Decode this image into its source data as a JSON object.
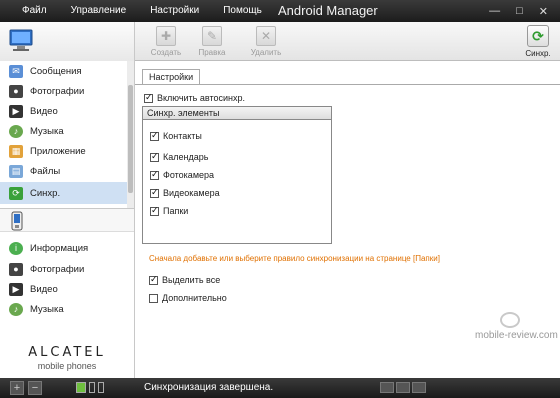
{
  "menu": {
    "items": [
      "Файл",
      "Управление",
      "Настройки",
      "Помощь"
    ]
  },
  "app_title": "Android Manager",
  "toolbar": {
    "create": "Создать",
    "edit": "Правка",
    "delete": "Удалить",
    "sync": "Синхр."
  },
  "sidebar": {
    "items": [
      "Сообщения",
      "Фотографии",
      "Видео",
      "Музыка",
      "Приложение",
      "Файлы",
      "Синхр."
    ],
    "device_items": [
      "Информация",
      "Фотографии",
      "Видео",
      "Музыка"
    ],
    "active": "Синхр."
  },
  "brand": {
    "name": "ALCATEL",
    "subtitle": "mobile phones"
  },
  "main": {
    "tab_settings": "Настройки",
    "auto_sync_label": "Включить автосинхр.",
    "group_title": "Синхр. элементы",
    "group_items": [
      "Контакты",
      "Календарь",
      "Фотокамера",
      "Видеокамера",
      "Папки"
    ],
    "hint": "Сначала добавьте или выберите правило синхронизации на странице [Папки]",
    "select_all": "Выделить все",
    "advanced": "Дополнительно"
  },
  "watermark": "mobile-review.com",
  "status": {
    "text": "Синхронизация завершена.",
    "add": "+",
    "remove": "−"
  },
  "colors": {
    "accent": "#cfe0f3",
    "hint": "#e07000",
    "titlebar": "#232323"
  }
}
